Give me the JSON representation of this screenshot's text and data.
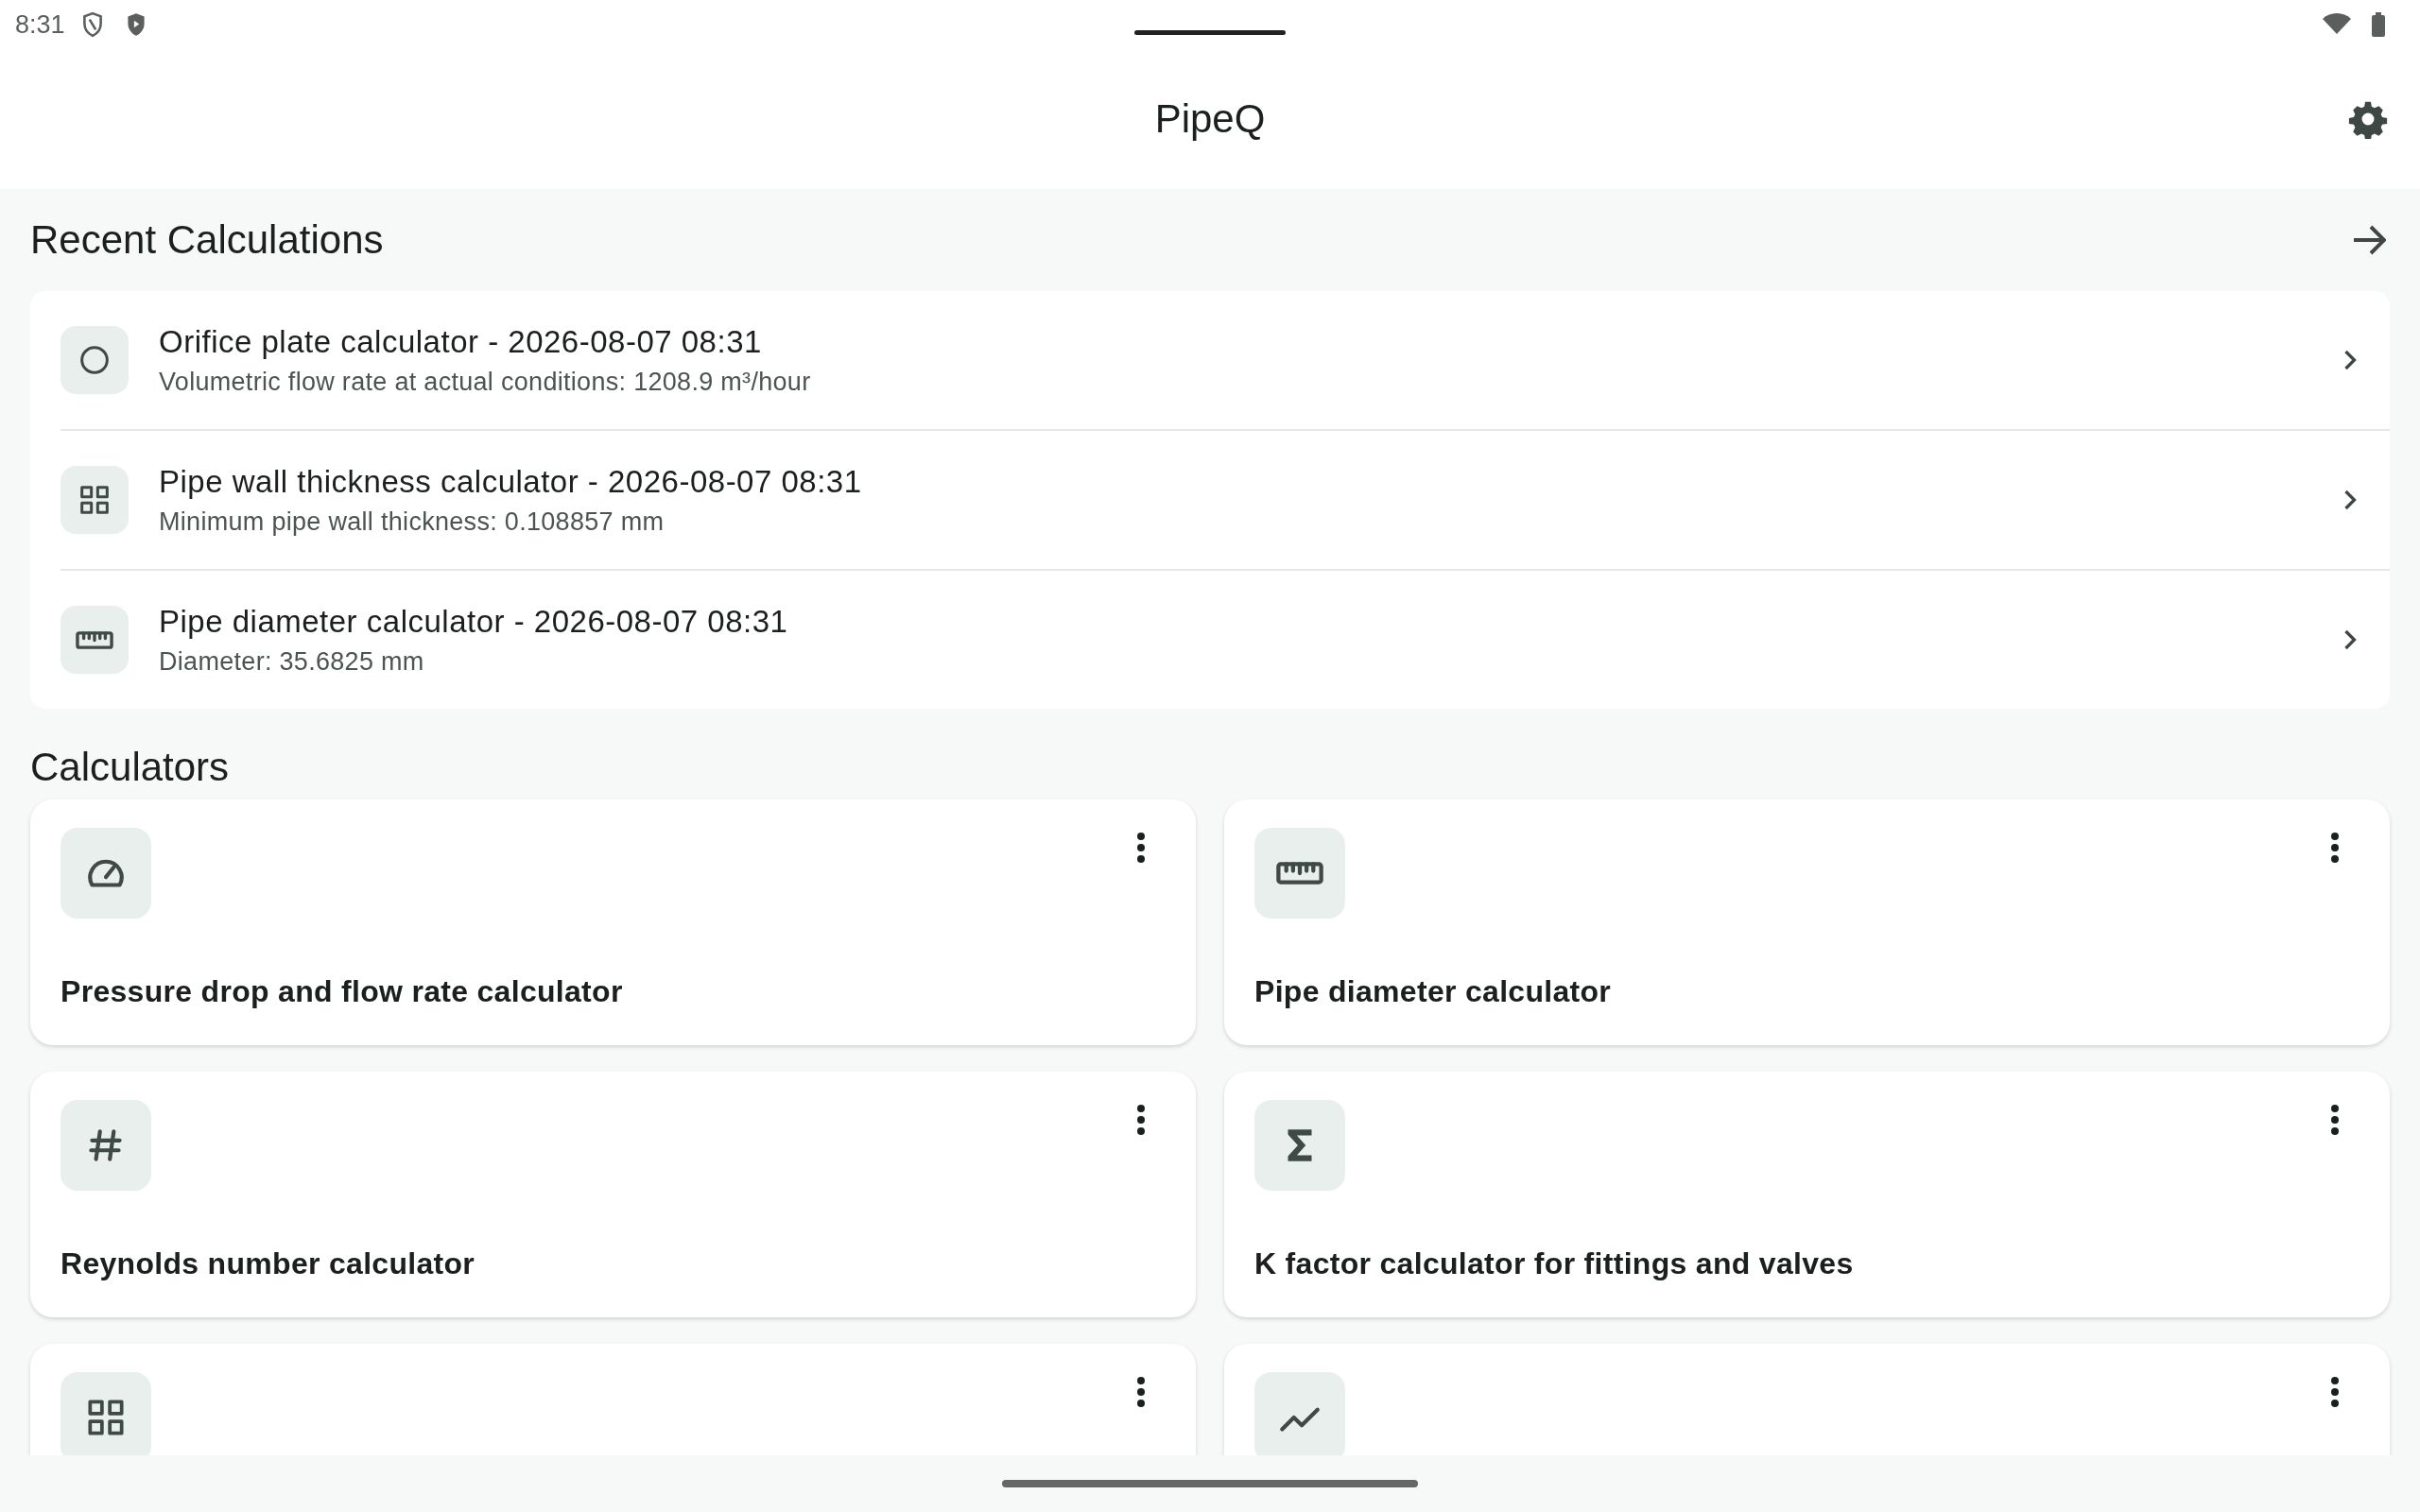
{
  "status_bar": {
    "time": "8:31"
  },
  "app_bar": {
    "title": "PipeQ"
  },
  "recent": {
    "title": "Recent Calculations",
    "items": [
      {
        "title": "Orifice plate calculator - 2026-08-07 08:31",
        "subtitle": "Volumetric flow rate at actual conditions: 1208.9 m³/hour"
      },
      {
        "title": "Pipe wall thickness calculator - 2026-08-07 08:31",
        "subtitle": "Minimum pipe wall thickness: 0.108857 mm"
      },
      {
        "title": "Pipe diameter calculator - 2026-08-07 08:31",
        "subtitle": "Diameter: 35.6825 mm"
      }
    ]
  },
  "calculators": {
    "title": "Calculators",
    "items": [
      {
        "kind": "full",
        "title": "Pressure drop and flow rate calculator"
      },
      {
        "kind": "full",
        "title": "Pipe diameter calculator"
      },
      {
        "kind": "full",
        "title": "Reynolds number calculator"
      },
      {
        "kind": "full",
        "title": "K factor calculator for fittings and valves"
      },
      {
        "kind": "partial"
      },
      {
        "kind": "partial"
      }
    ]
  }
}
